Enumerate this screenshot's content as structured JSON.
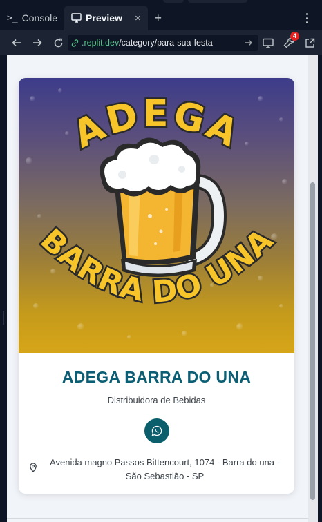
{
  "tabs": [
    {
      "label": "Console",
      "icon": "terminal-icon"
    },
    {
      "label": "Preview",
      "icon": "monitor-icon",
      "close": "×"
    }
  ],
  "tab_add": "+",
  "url": {
    "domain": ".replit.dev",
    "path": "/category/para-sua-festa"
  },
  "badge_count": "4",
  "colors": {
    "brand_teal": "#0b5e73",
    "whatsapp_button": "#0b5e6b",
    "url_green": "#58c28b",
    "badge_red": "#e52222"
  },
  "banner": {
    "logo_top_text": "ADEGA",
    "logo_bottom_text": "BARRA DO UNA"
  },
  "business": {
    "name": "ADEGA BARRA DO UNA",
    "subtitle": "Distribuidora de Bebidas",
    "address": "Avenida magno Passos Bittencourt, 1074 - Barra do una - São Sebastião - SP"
  }
}
